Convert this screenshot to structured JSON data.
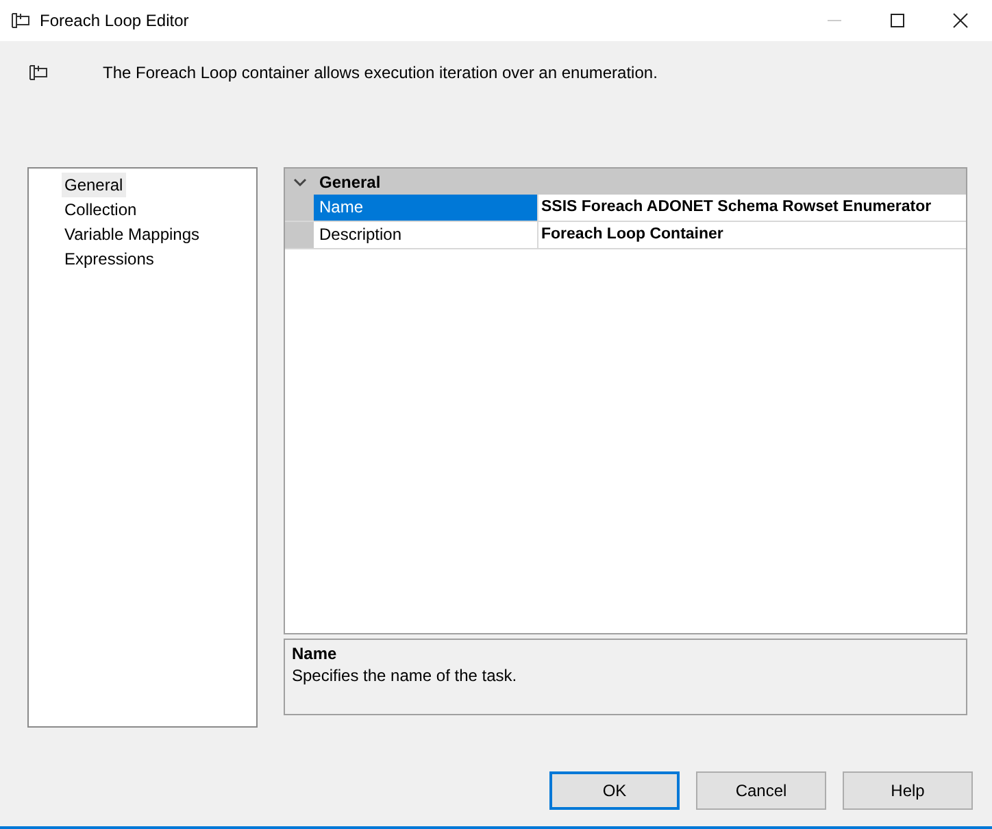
{
  "window": {
    "title": "Foreach Loop Editor"
  },
  "header": {
    "text": "The Foreach Loop container allows execution iteration over an enumeration."
  },
  "nav": [
    {
      "label": "General",
      "selected": true
    },
    {
      "label": "Collection",
      "selected": false
    },
    {
      "label": "Variable Mappings",
      "selected": false
    },
    {
      "label": "Expressions",
      "selected": false
    }
  ],
  "properties": {
    "category": {
      "label": "General",
      "expanded": true
    },
    "rows": [
      {
        "name": "Name",
        "value": "SSIS Foreach ADONET Schema Rowset Enumerator",
        "selected": true
      },
      {
        "name": "Description",
        "value": "Foreach Loop Container",
        "selected": false
      }
    ]
  },
  "help": {
    "title": "Name",
    "text": "Specifies the name of the task."
  },
  "buttons": [
    {
      "label": "OK",
      "default": true
    },
    {
      "label": "Cancel",
      "default": false
    },
    {
      "label": "Help",
      "default": false
    }
  ]
}
